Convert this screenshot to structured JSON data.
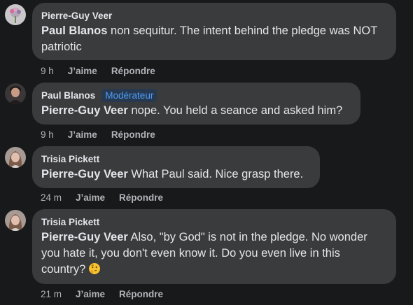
{
  "comments": [
    {
      "author": "Pierre-Guy Veer",
      "mention": "Paul Blanos",
      "text": " non sequitur. The intent behind the pledge was NOT patriotic",
      "time": "9 h",
      "like": "J’aime",
      "reply": "Répondre"
    },
    {
      "author": "Paul Blanos",
      "badge": "Modérateur",
      "mention": "Pierre-Guy Veer",
      "text": " nope. You held a seance and asked him?",
      "time": "9 h",
      "like": "J’aime",
      "reply": "Répondre"
    },
    {
      "author": "Trisia Pickett",
      "mention": "Pierre-Guy Veer",
      "text": " What Paul said. Nice grasp there.",
      "time": "24 m",
      "like": "J’aime",
      "reply": "Répondre"
    },
    {
      "author": "Trisia Pickett",
      "mention": "Pierre-Guy Veer",
      "text": " Also, \"by God\" is not in the pledge. No wonder you hate it, you don't even know it. Do you even live in this country?",
      "emoji": "thinking-face-icon",
      "time": "21 m",
      "like": "J’aime",
      "reply": "Répondre"
    }
  ],
  "colors": {
    "background": "#18191a",
    "bubble": "#3a3b3c",
    "text": "#e4e6eb",
    "secondary": "#b0b3b8",
    "badge_text": "#4f9cf5",
    "badge_bg": "#263951"
  }
}
